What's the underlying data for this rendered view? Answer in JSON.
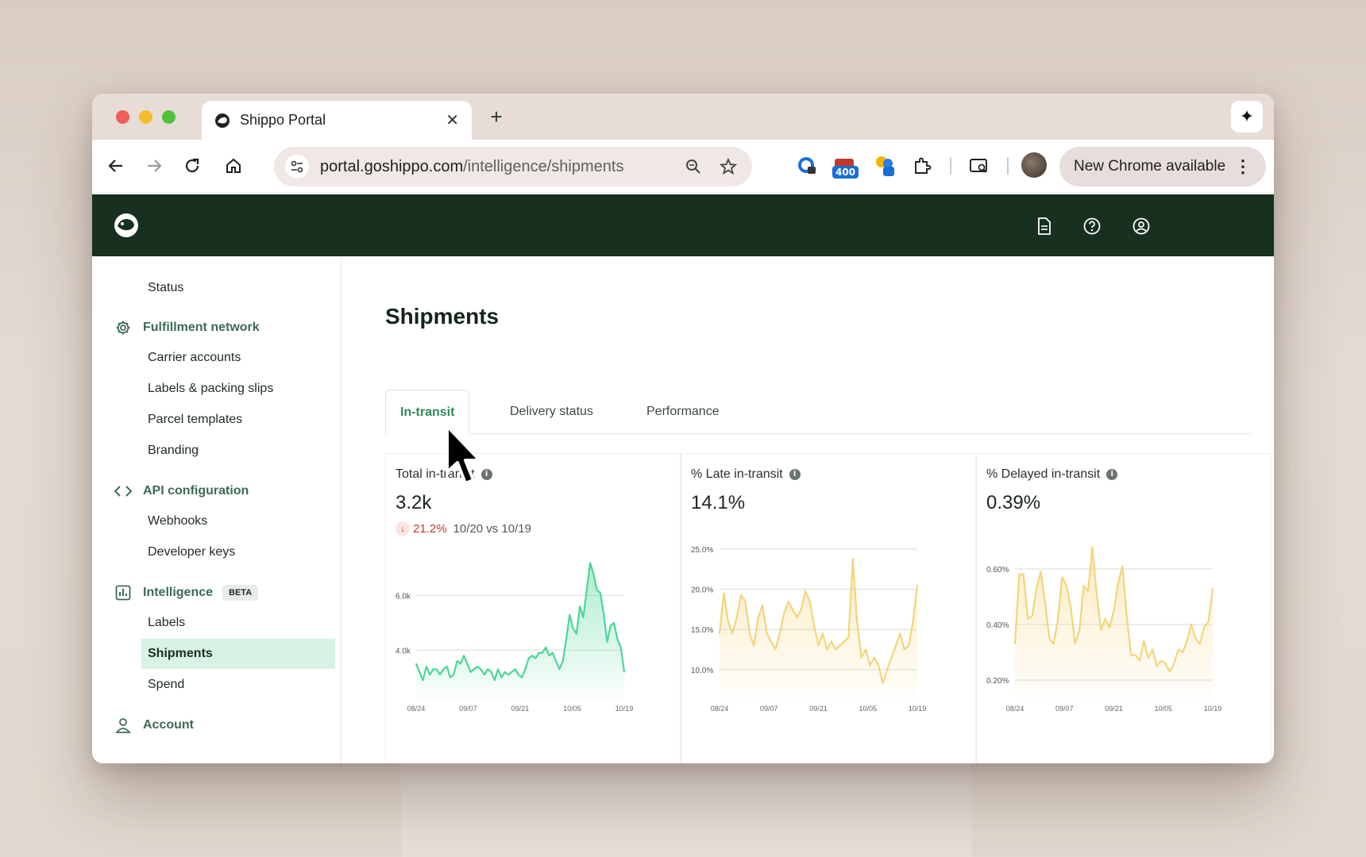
{
  "browser": {
    "tab_title": "Shippo Portal",
    "url_host": "portal.goshippo.com",
    "url_path": "/intelligence/shipments",
    "extension_badge": "400",
    "new_chrome_label": "New Chrome available"
  },
  "sidebar": {
    "status": "Status",
    "fulfillment": {
      "title": "Fulfillment network",
      "items": [
        "Carrier accounts",
        "Labels & packing slips",
        "Parcel templates",
        "Branding"
      ]
    },
    "api": {
      "title": "API configuration",
      "items": [
        "Webhooks",
        "Developer keys"
      ]
    },
    "intelligence": {
      "title": "Intelligence",
      "badge": "BETA",
      "items": [
        "Labels",
        "Shipments",
        "Spend"
      ],
      "active": "Shipments"
    },
    "account": {
      "title": "Account"
    }
  },
  "main": {
    "title": "Shipments",
    "tabs": [
      {
        "label": "In-transit",
        "active": true
      },
      {
        "label": "Delivery status",
        "active": false
      },
      {
        "label": "Performance",
        "active": false
      }
    ]
  },
  "colors": {
    "header_bg": "#17301f",
    "accent_green": "#2e8a5a",
    "active_nav_bg": "#d8f2e3",
    "chart_green": "#4cd696",
    "chart_yellow": "#f3d57a",
    "negative_red": "#c0392b"
  },
  "cards": [
    {
      "title": "Total in-transit",
      "value": "3.2k",
      "delta_pct": "21.2%",
      "delta_cmp": "10/20 vs 10/19"
    },
    {
      "title": "% Late in-transit",
      "value": "14.1%"
    },
    {
      "title": "% Delayed in-transit",
      "value": "0.39%"
    }
  ],
  "chart_data": [
    {
      "type": "area",
      "title": "Total in-transit",
      "color": "#4cd696",
      "yticks": [
        "6.0k",
        "4.0k"
      ],
      "ytick_values": [
        6000,
        4000
      ],
      "ylim": [
        2700,
        7700
      ],
      "xticks": [
        "08/24",
        "09/07",
        "09/21",
        "10/05",
        "10/19"
      ],
      "series": [
        {
          "values": [
            3500,
            3200,
            2900,
            3400,
            3100,
            3300,
            3300,
            3100,
            3300,
            3400,
            3000,
            3100,
            3600,
            3500,
            3800,
            3500,
            3200,
            3300,
            3400,
            3300,
            3100,
            3300,
            3200,
            2900,
            3300,
            3000,
            3200,
            3100,
            3200,
            3300,
            3100,
            3000,
            3300,
            3700,
            3800,
            3700,
            3900,
            3900,
            4100,
            3800,
            3900,
            3600,
            3300,
            3600,
            4400,
            5300,
            4800,
            4600,
            5600,
            5200,
            6200,
            7200,
            6800,
            6200,
            6100,
            5300,
            4300,
            4900,
            5000,
            4400,
            4100,
            3200
          ]
        }
      ]
    },
    {
      "type": "area",
      "title": "% Late in-transit",
      "color": "#f3d57a",
      "yticks": [
        "25.0%",
        "20.0%",
        "15.0%",
        "10.0%"
      ],
      "ytick_values": [
        25,
        20,
        15,
        10
      ],
      "ylim": [
        8,
        26
      ],
      "xticks": [
        "08/24",
        "09/07",
        "09/21",
        "10/05",
        "10/19"
      ],
      "series": [
        {
          "values": [
            14.5,
            19.5,
            16,
            14.5,
            16.5,
            19.3,
            18.5,
            14.5,
            13,
            16.5,
            18,
            14.5,
            13.5,
            12.5,
            14.5,
            17,
            18.5,
            17.5,
            16.5,
            17.5,
            19.8,
            18.5,
            15.5,
            13,
            14.5,
            12.5,
            13.5,
            12.5,
            13,
            13.5,
            14,
            23.8,
            16,
            11.5,
            12.5,
            10.5,
            11.5,
            10.5,
            8.3,
            10,
            11.5,
            13,
            14.5,
            12.5,
            13,
            16,
            20.5
          ]
        }
      ]
    },
    {
      "type": "area",
      "title": "% Delayed in-transit",
      "color": "#f3d57a",
      "yticks": [
        "0.60%",
        "0.40%",
        "0.20%"
      ],
      "ytick_values": [
        0.6,
        0.4,
        0.2
      ],
      "ylim": [
        0.18,
        0.7
      ],
      "xticks": [
        "08/24",
        "09/07",
        "09/21",
        "10/05",
        "10/19"
      ],
      "series": [
        {
          "values": [
            0.33,
            0.58,
            0.58,
            0.42,
            0.43,
            0.53,
            0.59,
            0.48,
            0.35,
            0.33,
            0.42,
            0.57,
            0.54,
            0.46,
            0.33,
            0.38,
            0.54,
            0.52,
            0.68,
            0.51,
            0.38,
            0.42,
            0.39,
            0.45,
            0.55,
            0.61,
            0.43,
            0.29,
            0.29,
            0.27,
            0.34,
            0.28,
            0.31,
            0.25,
            0.27,
            0.26,
            0.23,
            0.26,
            0.31,
            0.3,
            0.34,
            0.4,
            0.35,
            0.33,
            0.39,
            0.41,
            0.53
          ]
        }
      ]
    }
  ]
}
